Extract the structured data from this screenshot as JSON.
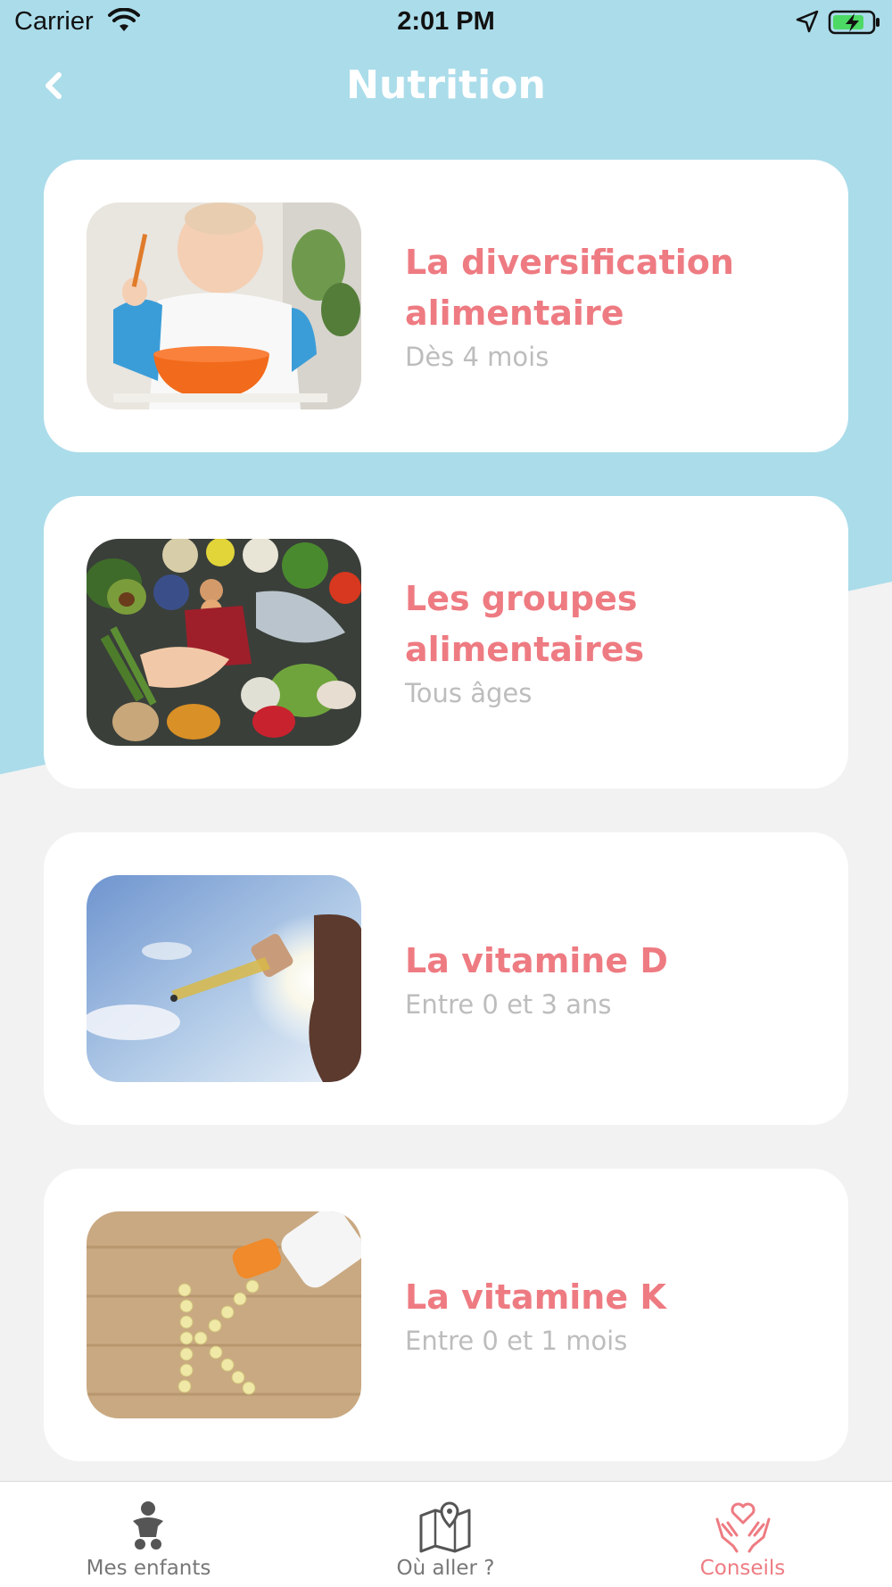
{
  "status_bar": {
    "carrier": "Carrier",
    "time": "2:01 PM",
    "icons": [
      "wifi-icon",
      "location-arrow-icon",
      "battery-charging-icon"
    ]
  },
  "header": {
    "title": "Nutrition",
    "back_icon": "chevron-left-icon"
  },
  "colors": {
    "header_background": "#abdcea",
    "page_background": "#f2f2f2",
    "accent": "#ee7b82",
    "subtitle": "#bdbdbd",
    "card_background": "#ffffff"
  },
  "articles": [
    {
      "title": "La diversification alimentaire",
      "subtitle": "Dès 4 mois",
      "image": "baby-eating-photo"
    },
    {
      "title": "Les groupes alimentaires",
      "subtitle": "Tous âges",
      "image": "food-groups-photo"
    },
    {
      "title": "La vitamine D",
      "subtitle": "Entre 0 et 3 ans",
      "image": "vitamin-d-dropper-photo"
    },
    {
      "title": "La vitamine K",
      "subtitle": "Entre 0 et 1 mois",
      "image": "vitamin-k-pills-photo"
    }
  ],
  "tab_bar": {
    "tabs": [
      {
        "label": "Mes enfants",
        "icon": "baby-icon",
        "active": false
      },
      {
        "label": "Où aller ?",
        "icon": "map-pin-icon",
        "active": false
      },
      {
        "label": "Conseils",
        "icon": "hands-heart-icon",
        "active": true
      }
    ]
  }
}
